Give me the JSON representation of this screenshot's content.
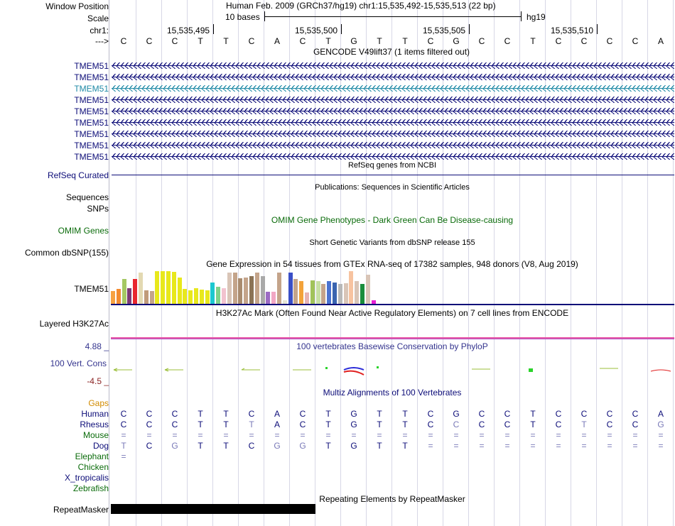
{
  "header": {
    "window_position_label": "Window Position",
    "scale_label": "Scale",
    "chr_label": "chr1:",
    "arrow_label": "--->",
    "assembly_position": "Human Feb. 2009 (GRCh37/hg19)   chr1:15,535,492-15,535,513 (22 bp)",
    "scale_text": "10 bases",
    "db": "hg19",
    "coords": [
      "15,535,495",
      "15,535,500",
      "15,535,505",
      "15,535,510"
    ],
    "bases": [
      "C",
      "C",
      "C",
      "T",
      "T",
      "C",
      "A",
      "C",
      "T",
      "G",
      "T",
      "T",
      "C",
      "G",
      "C",
      "C",
      "T",
      "C",
      "C",
      "C",
      "C",
      "A"
    ]
  },
  "gencode": {
    "title": "GENCODE V49lift37 (1 items filtered out)",
    "labels": [
      "TMEM51",
      "TMEM51",
      "TMEM51",
      "TMEM51",
      "TMEM51",
      "TMEM51",
      "TMEM51",
      "TMEM51",
      "TMEM51"
    ],
    "highlight_color": "#1f8aa6",
    "color": "#0c0c78"
  },
  "refseq": {
    "label": "RefSeq Curated",
    "title": "RefSeq genes from NCBI"
  },
  "publications": {
    "title": "Publications: Sequences in Scientific Articles",
    "label1": "Sequences",
    "label2": "SNPs"
  },
  "omim": {
    "title": "OMIM Gene Phenotypes - Dark Green Can Be Disease-causing",
    "label": "OMIM Genes",
    "color": "#0a6b0a"
  },
  "dbsnp": {
    "title": "Short Genetic Variants from dbSNP release 155",
    "label": "Common dbSNP(155)"
  },
  "gtex": {
    "title": "Gene Expression in 54 tissues from GTEx RNA-seq of 17382 samples, 948 donors (V8, Aug 2019)",
    "label": "TMEM51",
    "colors": [
      "#f7a242",
      "#f38b30",
      "#a5c863",
      "#7b3a75",
      "#e8262e",
      "#e3d9b2",
      "#c09b7a",
      "#c4a48a",
      "#e8e81c",
      "#e8e81c",
      "#e8e81c",
      "#e8e81c",
      "#e8e81c",
      "#e8e81c",
      "#e8e81c",
      "#e8e81c",
      "#e8e81c",
      "#e8e81c",
      "#1cc8d0",
      "#7fd18b",
      "#f2c3cf",
      "#d9c5b7",
      "#c4a48a",
      "#a98b6e",
      "#c4a48a",
      "#8b7355",
      "#c4a48a",
      "#a9a9a9",
      "#9c6bc4",
      "#f2a7c4",
      "#c4a48a",
      "#e4e4d4",
      "#3a4fc7",
      "#c4a48a",
      "#f3a33a",
      "#e6b3b3",
      "#a1c35a",
      "#c7e0a5",
      "#c4a48a",
      "#4a73d0",
      "#3a64b0",
      "#b8b8b8",
      "#d9c5b7",
      "#f7c3a0",
      "#d9c5b7",
      "#1a8d3c",
      "#d9c5b7",
      "#e61fd4"
    ],
    "values": [
      0.4,
      0.45,
      0.75,
      0.48,
      0.75,
      0.95,
      0.42,
      0.4,
      1.0,
      1.0,
      1.0,
      0.98,
      0.8,
      0.45,
      0.42,
      0.48,
      0.44,
      0.42,
      0.65,
      0.52,
      0.48,
      0.95,
      0.95,
      0.78,
      0.8,
      0.85,
      0.95,
      0.85,
      0.38,
      0.38,
      0.95,
      0.1,
      0.95,
      0.75,
      0.7,
      0.35,
      0.72,
      0.7,
      0.6,
      0.7,
      0.65,
      0.6,
      0.62,
      1.0,
      0.7,
      0.6,
      0.9,
      0.1
    ]
  },
  "h3k27ac": {
    "title": "H3K27Ac Mark (Often Found Near Active Regulatory Elements) on 7 cell lines from ENCODE",
    "label": "Layered H3K27Ac"
  },
  "phylop": {
    "title": "100 vertebrates Basewise Conservation by PhyloP",
    "label": "100 Vert. Cons",
    "ymax": "4.88 _",
    "ymin": "-4.5 _",
    "color": "#34348e"
  },
  "multiz": {
    "title": "Multiz Alignments of 100 Vertebrates",
    "gaps_label": "Gaps",
    "species": [
      {
        "name": "Human",
        "color": "#0c0c78",
        "seq": [
          "C",
          "C",
          "C",
          "T",
          "T",
          "C",
          "A",
          "C",
          "T",
          "G",
          "T",
          "T",
          "C",
          "G",
          "C",
          "C",
          "T",
          "C",
          "C",
          "C",
          "C",
          "A"
        ]
      },
      {
        "name": "Rhesus",
        "color": "#0c0c78",
        "seq": [
          "C",
          "C",
          "C",
          "T",
          "T",
          "T",
          "A",
          "C",
          "T",
          "G",
          "T",
          "T",
          "C",
          "C",
          "C",
          "C",
          "T",
          "C",
          "T",
          "C",
          "C",
          "G"
        ]
      },
      {
        "name": "Mouse",
        "color": "#0a6b0a",
        "seq": [
          "=",
          "=",
          "=",
          "=",
          "=",
          "=",
          "=",
          "=",
          "=",
          "=",
          "=",
          "=",
          "=",
          "=",
          "=",
          "=",
          "=",
          "=",
          "=",
          "=",
          "=",
          "="
        ]
      },
      {
        "name": "Dog",
        "color": "#0c0c78",
        "seq": [
          "T",
          "C",
          "G",
          "T",
          "T",
          "C",
          "G",
          "G",
          "T",
          "G",
          "T",
          "T",
          "=",
          "=",
          "=",
          "=",
          "=",
          "=",
          "=",
          "=",
          "=",
          "="
        ]
      },
      {
        "name": "Elephant",
        "color": "#0a6b0a",
        "seq": [
          "=",
          "",
          "",
          "",
          "",
          "",
          "",
          "",
          "",
          "",
          "",
          "",
          "",
          "",
          "",
          "",
          "",
          "",
          "",
          "",
          "",
          ""
        ]
      },
      {
        "name": "Chicken",
        "color": "#0a6b0a",
        "seq": []
      },
      {
        "name": "X_tropicalis",
        "color": "#0c0c78",
        "seq": []
      },
      {
        "name": "Zebrafish",
        "color": "#0a6b0a",
        "seq": []
      }
    ]
  },
  "repeatmasker": {
    "title": "Repeating Elements by RepeatMasker",
    "label": "RepeatMasker"
  }
}
